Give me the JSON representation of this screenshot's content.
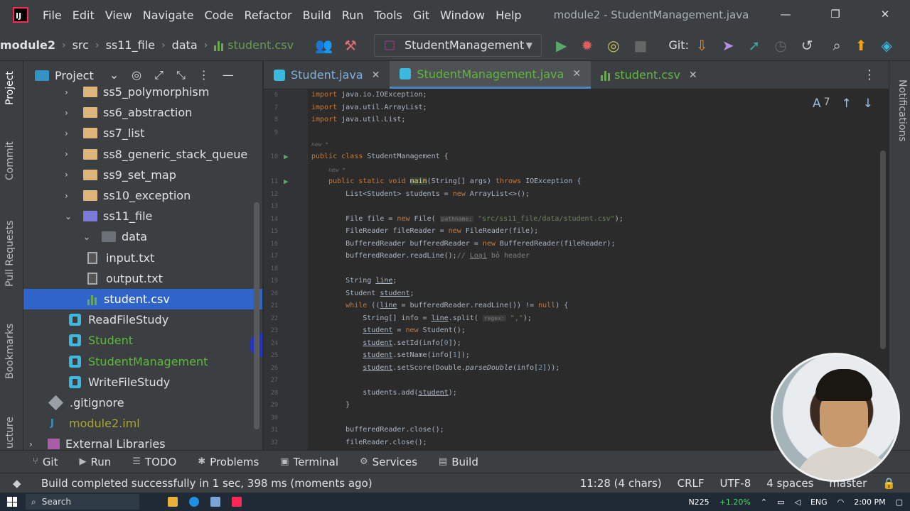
{
  "titlebar": {
    "menu": [
      "File",
      "Edit",
      "View",
      "Navigate",
      "Code",
      "Refactor",
      "Build",
      "Run",
      "Tools",
      "Git",
      "Window",
      "Help"
    ],
    "title": "module2 - StudentManagement.java"
  },
  "navbar": {
    "breadcrumbs": [
      "module2",
      "src",
      "ss11_file",
      "data",
      "student.csv"
    ],
    "run_config": "StudentManagement",
    "git_label": "Git:"
  },
  "left_strip": [
    "Project",
    "Commit",
    "Pull Requests",
    "Bookmarks",
    "ucture"
  ],
  "project": {
    "title": "Project",
    "tree": [
      {
        "label": "ss5_polymorphism",
        "kind": "folder",
        "depth": 1,
        "arrow": "›"
      },
      {
        "label": "ss6_abstraction",
        "kind": "folder",
        "depth": 1,
        "arrow": "›"
      },
      {
        "label": "ss7_list",
        "kind": "folder",
        "depth": 1,
        "arrow": "›"
      },
      {
        "label": "ss8_generic_stack_queue",
        "kind": "folder",
        "depth": 1,
        "arrow": "›"
      },
      {
        "label": "ss9_set_map",
        "kind": "folder",
        "depth": 1,
        "arrow": "›"
      },
      {
        "label": "ss10_exception",
        "kind": "folder",
        "depth": 1,
        "arrow": "›"
      },
      {
        "label": "ss11_file",
        "kind": "folder-open",
        "depth": 1,
        "arrow": "⌄"
      },
      {
        "label": "data",
        "kind": "folder-dark",
        "depth": 2,
        "arrow": "⌄"
      },
      {
        "label": "input.txt",
        "kind": "text",
        "depth": 3,
        "arrow": ""
      },
      {
        "label": "output.txt",
        "kind": "text",
        "depth": 3,
        "arrow": ""
      },
      {
        "label": "student.csv",
        "kind": "csv",
        "depth": 3,
        "arrow": "",
        "selected": true
      },
      {
        "label": "ReadFileStudy",
        "kind": "java",
        "depth": 2,
        "arrow": ""
      },
      {
        "label": "Student",
        "kind": "java-green",
        "depth": 2,
        "arrow": ""
      },
      {
        "label": "StudentManagement",
        "kind": "java-green",
        "depth": 2,
        "arrow": ""
      },
      {
        "label": "WriteFileStudy",
        "kind": "java",
        "depth": 2,
        "arrow": ""
      },
      {
        "label": ".gitignore",
        "kind": "git",
        "depth": 1,
        "arrow": ""
      },
      {
        "label": "module2.iml",
        "kind": "iml",
        "depth": 1,
        "arrow": ""
      },
      {
        "label": "External Libraries",
        "kind": "lib",
        "depth": 0,
        "arrow": "›"
      }
    ]
  },
  "editor_tabs": [
    {
      "label": "Student.java",
      "kind": "java",
      "active": false
    },
    {
      "label": "StudentManagement.java",
      "kind": "java",
      "active": true
    },
    {
      "label": "student.csv",
      "kind": "csv",
      "active": false
    }
  ],
  "inspection_count": "7",
  "code_lines": [
    {
      "n": "6",
      "html": "<span class='kw'>import</span> java.io.IOException;"
    },
    {
      "n": "7",
      "html": "<span class='kw'>import</span> java.util.ArrayList;"
    },
    {
      "n": "8",
      "html": "<span class='kw'>import</span> java.util.List;"
    },
    {
      "n": "9",
      "html": ""
    },
    {
      "n": "",
      "html": "<span class='author'>new *</span>"
    },
    {
      "n": "10",
      "html": "<span class='kw'>public class</span> StudentManagement {",
      "run": true
    },
    {
      "n": "",
      "html": "    <span class='author'>new *</span>"
    },
    {
      "n": "11",
      "html": "    <span class='kw'>public static void</span> <span class='mhl fn'>main</span>(String[] args) <span class='kw'>throws</span> IOException {",
      "run": true
    },
    {
      "n": "12",
      "html": "        List&lt;Student&gt; students = <span class='kw'>new</span> ArrayList&lt;&gt;();"
    },
    {
      "n": "13",
      "html": ""
    },
    {
      "n": "14",
      "html": "        File file = <span class='kw'>new</span> File( <span class='hint'>pathname:</span> <span class='str'>\"src/ss11_file/data/student.csv\"</span>);"
    },
    {
      "n": "15",
      "html": "        FileReader fileReader = <span class='kw'>new</span> FileReader(file);"
    },
    {
      "n": "16",
      "html": "        BufferedReader bufferedReader = <span class='kw'>new</span> BufferedReader(fileReader);"
    },
    {
      "n": "17",
      "html": "        bufferedReader.readLine();<span class='cm'>// <span class='ul'>Loại</span> bỏ header</span>"
    },
    {
      "n": "18",
      "html": ""
    },
    {
      "n": "19",
      "html": "        String <span class='ul'>line</span>;"
    },
    {
      "n": "20",
      "html": "        Student <span class='ul'>student</span>;"
    },
    {
      "n": "21",
      "html": "        <span class='kw'>while</span> ((<span class='ul'>line</span> = bufferedReader.readLine()) != <span class='kw'>null</span>) {"
    },
    {
      "n": "22",
      "html": "            String[] info = <span class='ul'>line</span>.split( <span class='hint'>regex:</span> <span class='str'>\",\"</span>);"
    },
    {
      "n": "23",
      "html": "            <span class='ul'>student</span> = <span class='kw'>new</span> Student();"
    },
    {
      "n": "24",
      "html": "            <span class='ul'>student</span>.setId(info[<span class='t-blue'>0</span>]);"
    },
    {
      "n": "25",
      "html": "            <span class='ul'>student</span>.setName(info[<span class='t-blue'>1</span>]);"
    },
    {
      "n": "26",
      "html": "            <span class='ul'>student</span>.setScore(Double.<i>parseDouble</i>(info[<span class='t-blue'>2</span>]));"
    },
    {
      "n": "27",
      "html": ""
    },
    {
      "n": "28",
      "html": "            students.add(<span class='ul'>student</span>);"
    },
    {
      "n": "29",
      "html": "        }"
    },
    {
      "n": "30",
      "html": ""
    },
    {
      "n": "31",
      "html": "        bufferedReader.close();"
    },
    {
      "n": "32",
      "html": "        fileReader.close();"
    }
  ],
  "right_strip": "Notifications",
  "bottom_tools": [
    {
      "label": "Git",
      "icon": "⑂"
    },
    {
      "label": "Run",
      "icon": "▶"
    },
    {
      "label": "TODO",
      "icon": "☰"
    },
    {
      "label": "Problems",
      "icon": "✱"
    },
    {
      "label": "Terminal",
      "icon": "▣"
    },
    {
      "label": "Services",
      "icon": "⚙"
    },
    {
      "label": "Build",
      "icon": "▤"
    }
  ],
  "status": {
    "message": "Build completed successfully in 1 sec, 398 ms (moments ago)",
    "position": "11:28 (4 chars)",
    "line_ending": "CRLF",
    "encoding": "UTF-8",
    "indent": "4 spaces",
    "branch": "master"
  },
  "taskbar": {
    "search_placeholder": "Search",
    "stock": "N225",
    "stock_change": "+1.20%",
    "lang": "ENG",
    "time": "2:00 PM"
  }
}
